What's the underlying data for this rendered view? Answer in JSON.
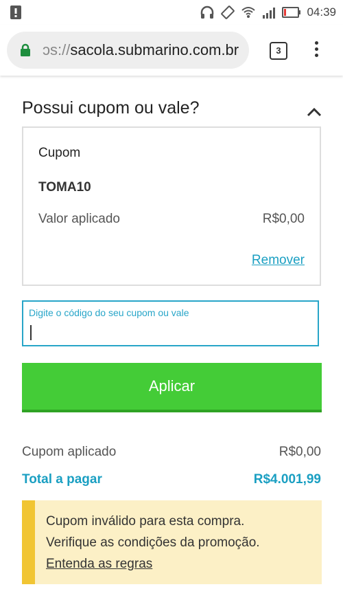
{
  "status_bar": {
    "time": "04:39",
    "icons": [
      "alert-icon",
      "headphones-icon",
      "rotate-icon",
      "wifi-icon",
      "signal-icon",
      "battery-icon"
    ]
  },
  "browser": {
    "url_prefix": "ɔs://",
    "url_host": "sacola.submarino.com.br",
    "tab_count": "3"
  },
  "coupon_section": {
    "title": "Possui cupom ou vale?",
    "card": {
      "label": "Cupom",
      "code": "TOMA10",
      "applied_label": "Valor aplicado",
      "applied_value": "R$0,00",
      "remove_label": "Remover"
    },
    "input": {
      "label": "Digite o código do seu cupom ou vale",
      "value": ""
    },
    "apply_label": "Aplicar"
  },
  "summary": {
    "coupon_applied_label": "Cupom aplicado",
    "coupon_applied_value": "R$0,00",
    "total_label": "Total a pagar",
    "total_value": "R$4.001,99"
  },
  "warning": {
    "line1": "Cupom inválido para esta compra.",
    "line2": "Verifique as condições da promoção.",
    "link": "Entenda as regras"
  },
  "colors": {
    "accent_blue": "#1a9fc2",
    "apply_green": "#44cc37",
    "warning_bg": "#fcf0c6",
    "warning_bar": "#f1c533",
    "secure_green": "#1e8e3e"
  }
}
